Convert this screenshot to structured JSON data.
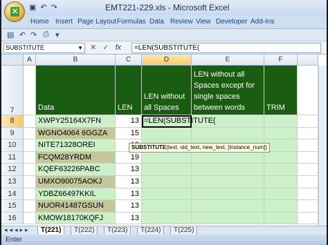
{
  "window": {
    "title": "EMT221-229.xls - Microsoft Excel"
  },
  "ribbon": {
    "tabs": [
      "Home",
      "Insert",
      "Page Layout",
      "Formulas",
      "Data",
      "Review",
      "View",
      "Developer",
      "Add-Ins"
    ]
  },
  "formula_bar": {
    "name_box": "SUBSTITUTE",
    "formula": "=LEN(SUBSTITUTE("
  },
  "columns": [
    "A",
    "B",
    "C",
    "D",
    "E",
    "F"
  ],
  "rows": [
    "7",
    "8",
    "9",
    "10",
    "11",
    "12",
    "13",
    "14",
    "15",
    "16"
  ],
  "header_row": {
    "data": "Data",
    "len": "LEN",
    "len_no_spaces": "LEN without all Spaces",
    "len_single_spaces": "LEN without all Spaces except for single spaces between words",
    "trim": "TRIM"
  },
  "data_rows": [
    {
      "text": "XWPY25164X7FN",
      "len": "13"
    },
    {
      "text": "WGNO4064  6GGZA",
      "len": "15"
    },
    {
      "text": "NITE71328OREI",
      "len": "13"
    },
    {
      "text": "FCQM28YRDM",
      "len": "19"
    },
    {
      "text": "KQEF63226PABC",
      "len": "13"
    },
    {
      "text": "UMXO90075AOKJ",
      "len": "13"
    },
    {
      "text": "YDBZ66497KKIL",
      "len": "13"
    },
    {
      "text": "NUOR41487GSUN",
      "len": "13"
    },
    {
      "text": "KMOW18170KQFJ",
      "len": "13"
    }
  ],
  "active_cell_text": "=LEN(SUBSTITUTE(",
  "tooltip": {
    "fn": "SUBSTITUTE",
    "args": "(text, old_text, new_text, [instance_num])"
  },
  "sheet_tabs": [
    "T(221)",
    "T(222)",
    "T(223)",
    "T(224)",
    "T(225)"
  ],
  "status": "Enter"
}
